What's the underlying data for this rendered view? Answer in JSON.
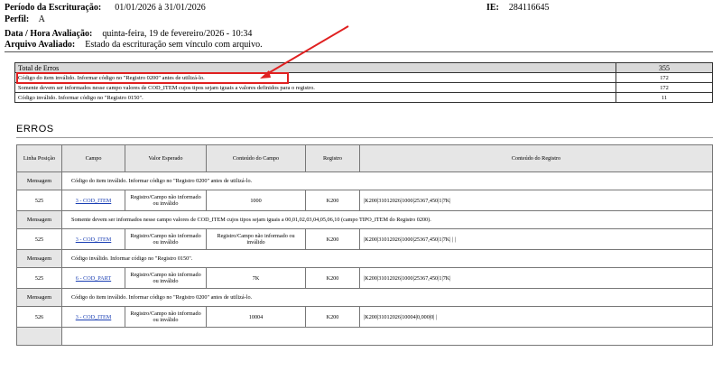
{
  "header": {
    "periodo_label": "Período da Escrituração:",
    "periodo_value": "01/01/2026 à 31/01/2026",
    "ie_label": "IE:",
    "ie_value": "284116645",
    "perfil_label": "Perfil:",
    "perfil_value": "A",
    "data_label": "Data / Hora Avaliação:",
    "data_value": "quinta-feira, 19 de fevereiro/2026 - 10:34",
    "arquivo_label": "Arquivo Avaliado:",
    "arquivo_value": "Estado da escrituração sem vínculo com arquivo."
  },
  "summary": {
    "total_label": "Total de Erros",
    "total_value": "355",
    "rows": [
      {
        "text": "Código do item inválido. Informar código no \"Registro 0200\" antes de utilizá-lo.",
        "value": "172"
      },
      {
        "text": "Somente devem ser informados nesse campo valores de COD_ITEM cujos tipos sejam iguais a valores definidos para o registro.",
        "value": "172"
      },
      {
        "text": "Código inválido. Informar código no \"Registro 0150\".",
        "value": "11"
      }
    ]
  },
  "errors": {
    "title": "ERROS",
    "columns": [
      "Linha Posição",
      "Campo",
      "Valor Esperado",
      "Conteúdo do Campo",
      "Registro",
      "Conteúdo do Registro"
    ],
    "message_label": "Mensagem",
    "groups": [
      {
        "message": "Código do item inválido. Informar código no \"Registro 0200\" antes de utilizá-lo.",
        "row": {
          "linha": "525",
          "campo": "3 - COD_ITEM",
          "valor_esperado": "Registro/Campo não informado ou inválido",
          "conteudo_campo": "1000",
          "registro": "K200",
          "conteudo_registro": "|K200|31012026|1000|25367,450|1|7K|"
        }
      },
      {
        "message": "Somente devem ser informados nesse campo valores de COD_ITEM cujos tipos sejam iguais a 00,01,02,03,04,05,06,10 (campo TIPO_ITEM do Registro 0200).",
        "row": {
          "linha": "525",
          "campo": "3 - COD_ITEM",
          "valor_esperado": "Registro/Campo não informado ou inválido",
          "conteudo_campo": "Registro/Campo não informado ou inválido",
          "registro": "K200",
          "conteudo_registro": "|K200|31012026|1000|25367,450|1|7K| | |"
        }
      },
      {
        "message": "Código inválido. Informar código no \"Registro 0150\".",
        "row": {
          "linha": "525",
          "campo": "6 - COD_PART",
          "valor_esperado": "Registro/Campo não informado ou inválido",
          "conteudo_campo": "7K",
          "registro": "K200",
          "conteudo_registro": "|K200|31012026|1000|25367,450|1|7K|"
        }
      },
      {
        "message": "Código do item inválido. Informar código no \"Registro 0200\" antes de utilizá-lo.",
        "row": {
          "linha": "526",
          "campo": "3 - COD_ITEM",
          "valor_esperado": "Registro/Campo não informado ou inválido",
          "conteudo_campo": "10004",
          "registro": "K200",
          "conteudo_registro": "|K200|31012026|10004|0,000|0| |"
        }
      }
    ]
  },
  "colors": {
    "annotation": "#e02020",
    "link": "#1a3fb4",
    "header_bg": "#e6e6e6"
  }
}
